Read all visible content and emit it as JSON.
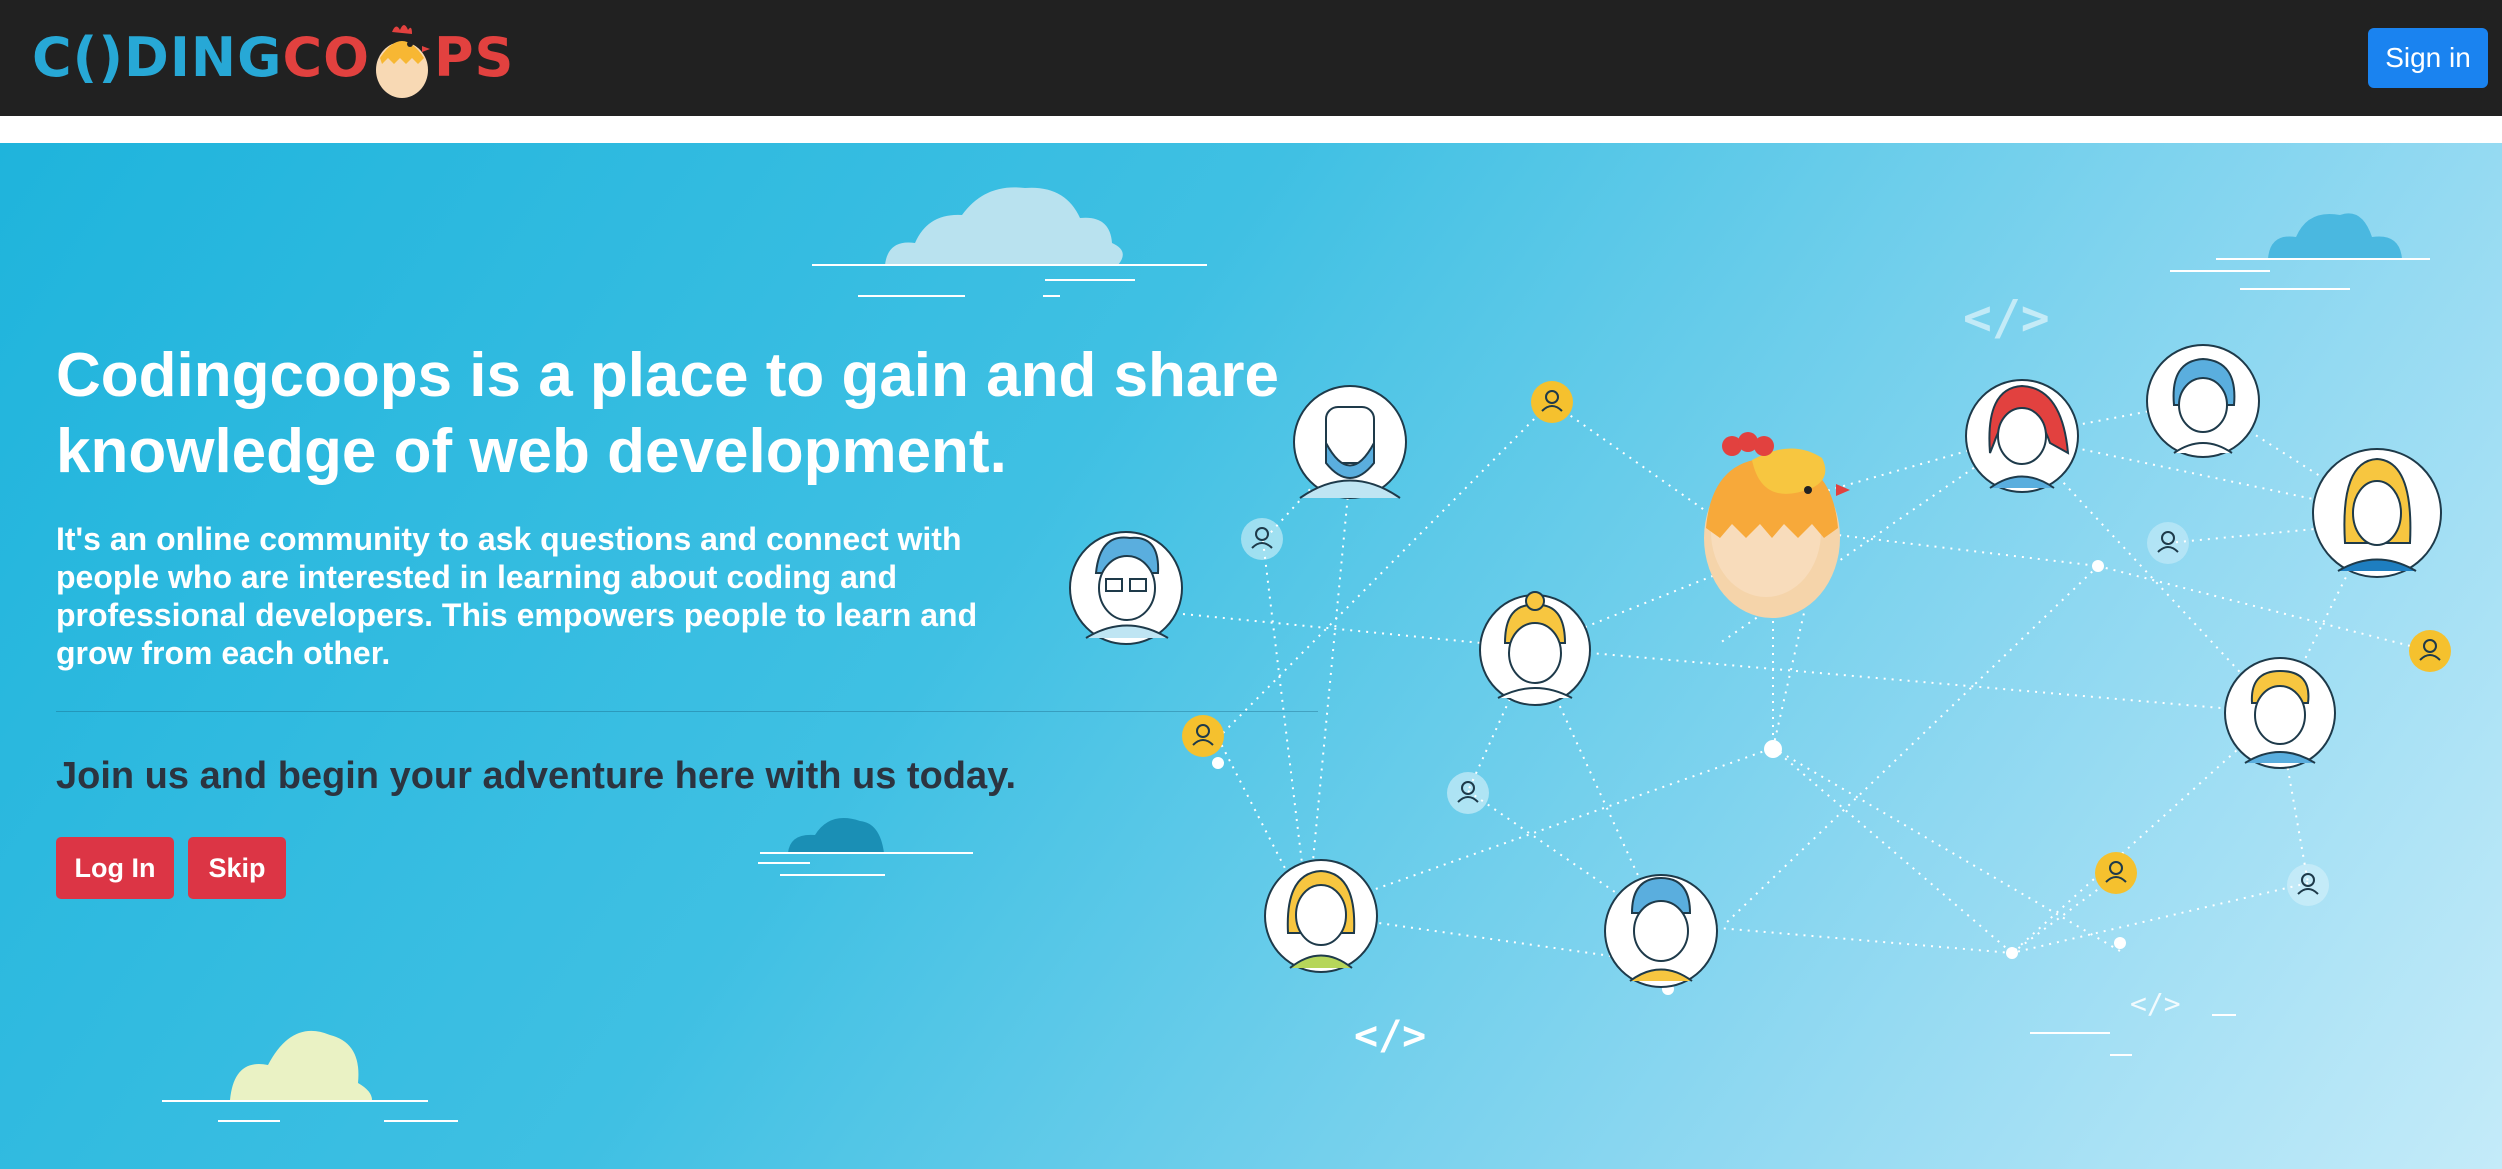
{
  "header": {
    "logo_part1": "C",
    "logo_part2": "()",
    "logo_part3": "DING",
    "logo_part4": "CO",
    "logo_part5": "PS",
    "signin_label": "Sign in"
  },
  "hero": {
    "title": "Codingcoops is a place to gain and share knowledge of web development.",
    "description": "It's an online community to ask questions and connect with people who are interested in learning about coding and professional developers. This empowers people to learn and grow from each other.",
    "cta": "Join us and begin your adventure here with us today.",
    "login_label": "Log In",
    "skip_label": "Skip",
    "code_tag_large": "</>",
    "code_tag_small": "</>"
  },
  "colors": {
    "topbar": "#212121",
    "signin": "#1a83f0",
    "brand_blue": "#27a8d6",
    "brand_red": "#e2413f",
    "action_red": "#dc3545",
    "hero_gradient_start": "#1fb4dc",
    "hero_gradient_end": "#c4ebf9",
    "user_badge_yellow": "#f5c12e"
  },
  "icons": {
    "logo_egg": "chick-egg-icon",
    "network_center": "chick-egg-mascot-icon",
    "avatar": "avatar-icon",
    "user": "user-icon",
    "cloud": "cloud-icon",
    "code": "code-tag-icon"
  }
}
